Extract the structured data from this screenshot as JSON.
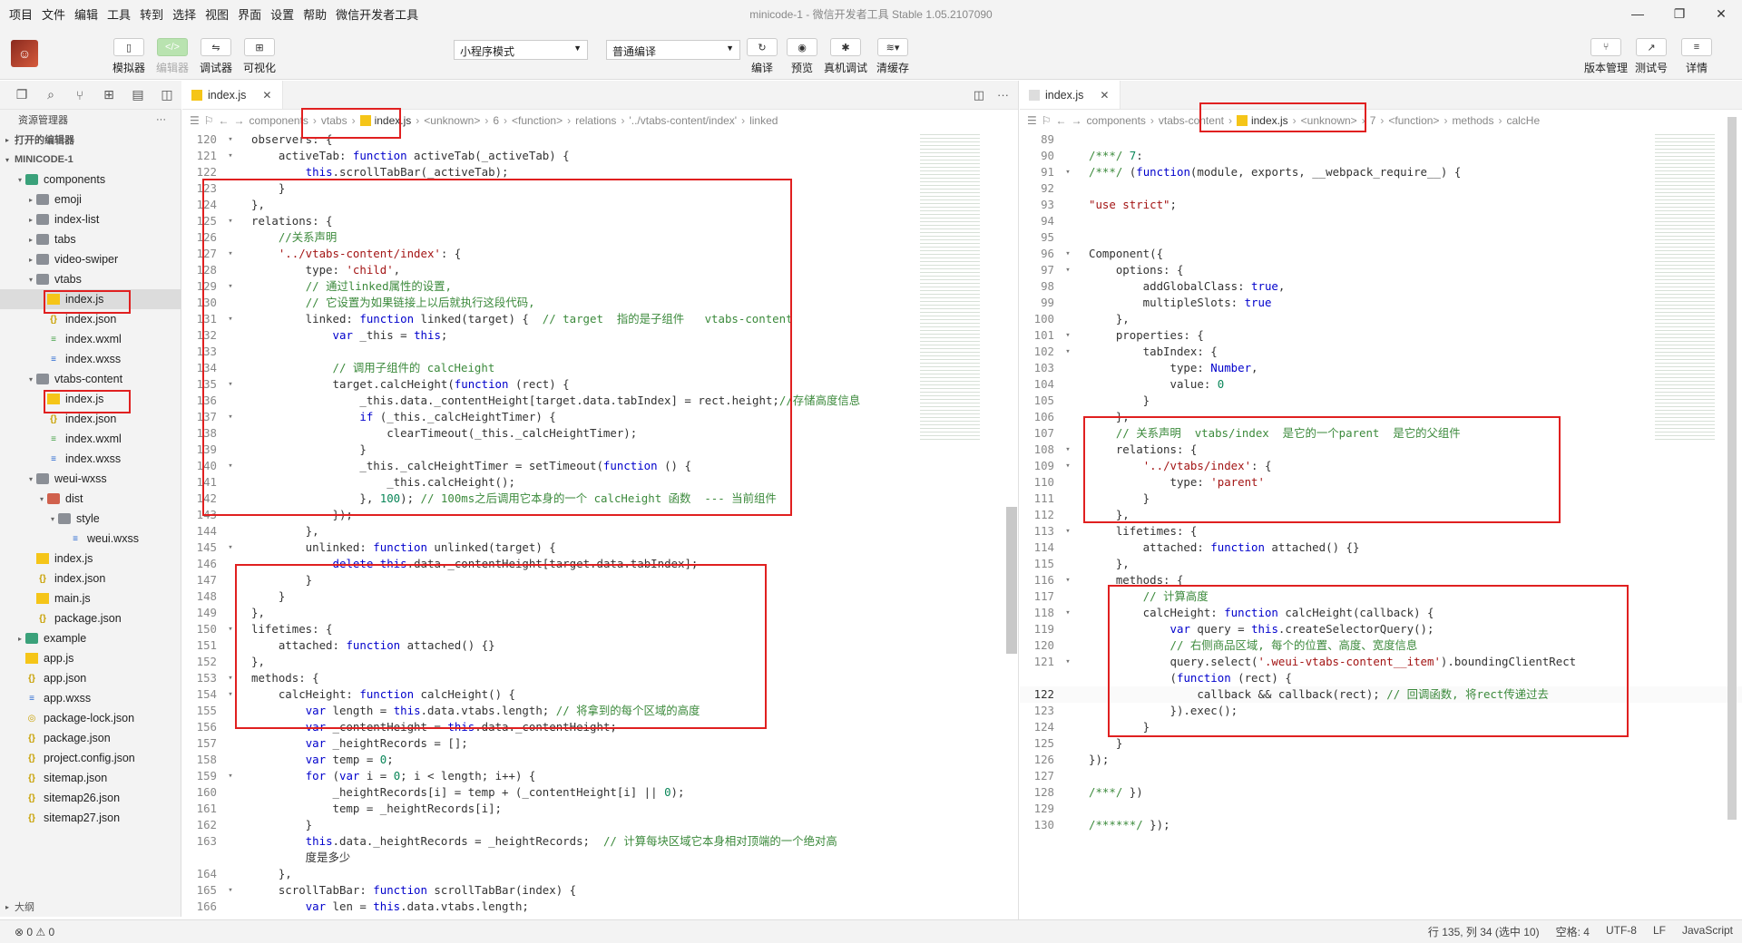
{
  "menu": [
    "项目",
    "文件",
    "编辑",
    "工具",
    "转到",
    "选择",
    "视图",
    "界面",
    "设置",
    "帮助",
    "微信开发者工具"
  ],
  "window_title": "minicode-1 - 微信开发者工具 Stable 1.05.2107090",
  "toolbar": {
    "left": [
      "模拟器",
      "编辑器",
      "调试器",
      "可视化"
    ],
    "mode_select": "小程序模式",
    "compile_select": "普通编译",
    "mid": [
      "编译",
      "预览",
      "真机调试",
      "清缓存"
    ],
    "right": [
      "版本管理",
      "测试号",
      "详情"
    ]
  },
  "sidebar": {
    "title": "资源管理器",
    "open_editors": "打开的编辑器",
    "project": "MINICODE-1",
    "outline": "大纲",
    "items": [
      {
        "depth": 1,
        "arrow": "▾",
        "icon": "folder-green",
        "name": "components"
      },
      {
        "depth": 2,
        "arrow": "▸",
        "icon": "folder",
        "name": "emoji"
      },
      {
        "depth": 2,
        "arrow": "▸",
        "icon": "folder",
        "name": "index-list"
      },
      {
        "depth": 2,
        "arrow": "▸",
        "icon": "folder",
        "name": "tabs"
      },
      {
        "depth": 2,
        "arrow": "▸",
        "icon": "folder",
        "name": "video-swiper"
      },
      {
        "depth": 2,
        "arrow": "▾",
        "icon": "folder",
        "name": "vtabs"
      },
      {
        "depth": 3,
        "arrow": "",
        "icon": "js",
        "name": "index.js",
        "selected": true,
        "hl": true
      },
      {
        "depth": 3,
        "arrow": "",
        "icon": "json",
        "name": "index.json"
      },
      {
        "depth": 3,
        "arrow": "",
        "icon": "wxml",
        "name": "index.wxml"
      },
      {
        "depth": 3,
        "arrow": "",
        "icon": "wxss",
        "name": "index.wxss"
      },
      {
        "depth": 2,
        "arrow": "▾",
        "icon": "folder",
        "name": "vtabs-content"
      },
      {
        "depth": 3,
        "arrow": "",
        "icon": "js",
        "name": "index.js",
        "hl": true
      },
      {
        "depth": 3,
        "arrow": "",
        "icon": "json",
        "name": "index.json"
      },
      {
        "depth": 3,
        "arrow": "",
        "icon": "wxml",
        "name": "index.wxml"
      },
      {
        "depth": 3,
        "arrow": "",
        "icon": "wxss",
        "name": "index.wxss"
      },
      {
        "depth": 2,
        "arrow": "▾",
        "icon": "folder",
        "name": "weui-wxss"
      },
      {
        "depth": 3,
        "arrow": "▾",
        "icon": "folder-red",
        "name": "dist"
      },
      {
        "depth": 4,
        "arrow": "▾",
        "icon": "folder",
        "name": "style"
      },
      {
        "depth": 5,
        "arrow": "",
        "icon": "wxss",
        "name": "weui.wxss"
      },
      {
        "depth": 2,
        "arrow": "",
        "icon": "js",
        "name": "index.js"
      },
      {
        "depth": 2,
        "arrow": "",
        "icon": "json",
        "name": "index.json"
      },
      {
        "depth": 2,
        "arrow": "",
        "icon": "js",
        "name": "main.js"
      },
      {
        "depth": 2,
        "arrow": "",
        "icon": "json",
        "name": "package.json"
      },
      {
        "depth": 1,
        "arrow": "▸",
        "icon": "folder-green",
        "name": "example"
      },
      {
        "depth": 1,
        "arrow": "",
        "icon": "js",
        "name": "app.js"
      },
      {
        "depth": 1,
        "arrow": "",
        "icon": "json",
        "name": "app.json"
      },
      {
        "depth": 1,
        "arrow": "",
        "icon": "wxss",
        "name": "app.wxss"
      },
      {
        "depth": 1,
        "arrow": "",
        "icon": "lock",
        "name": "package-lock.json"
      },
      {
        "depth": 1,
        "arrow": "",
        "icon": "json",
        "name": "package.json"
      },
      {
        "depth": 1,
        "arrow": "",
        "icon": "json",
        "name": "project.config.json"
      },
      {
        "depth": 1,
        "arrow": "",
        "icon": "json",
        "name": "sitemap.json"
      },
      {
        "depth": 1,
        "arrow": "",
        "icon": "json",
        "name": "sitemap26.json"
      },
      {
        "depth": 1,
        "arrow": "",
        "icon": "json",
        "name": "sitemap27.json"
      }
    ]
  },
  "left_editor": {
    "tab": "index.js",
    "breadcrumbs": [
      "components",
      "vtabs",
      "index.js",
      "<unknown>",
      "6",
      "<function>",
      "relations",
      "'../vtabs-content/index'",
      "linked"
    ],
    "lines": [
      [
        "120",
        "▾",
        "observers: {"
      ],
      [
        "121",
        "▾",
        "    activeTab: function activeTab(_activeTab) {"
      ],
      [
        "122",
        "",
        "        this.scrollTabBar(_activeTab);"
      ],
      [
        "123",
        "",
        "    }"
      ],
      [
        "124",
        "",
        "},"
      ],
      [
        "125",
        "▾",
        "relations: {"
      ],
      [
        "126",
        "",
        "    //关系声明"
      ],
      [
        "127",
        "▾",
        "    '../vtabs-content/index': {"
      ],
      [
        "128",
        "",
        "        type: 'child',"
      ],
      [
        "129",
        "▾",
        "        // 通过linked属性的设置,"
      ],
      [
        "130",
        "",
        "        // 它设置为如果链接上以后就执行这段代码,"
      ],
      [
        "131",
        "▾",
        "        linked: function linked(target) {  // target  指的是子组件   vtabs-content"
      ],
      [
        "132",
        "",
        "            var _this = this;"
      ],
      [
        "133",
        "",
        ""
      ],
      [
        "134",
        "",
        "            // 调用子组件的 calcHeight"
      ],
      [
        "135",
        "▾",
        "            target.calcHeight(function (rect) {"
      ],
      [
        "136",
        "",
        "                _this.data._contentHeight[target.data.tabIndex] = rect.height;//存储高度信息"
      ],
      [
        "137",
        "▾",
        "                if (_this._calcHeightTimer) {"
      ],
      [
        "138",
        "",
        "                    clearTimeout(_this._calcHeightTimer);"
      ],
      [
        "139",
        "",
        "                }"
      ],
      [
        "140",
        "▾",
        "                _this._calcHeightTimer = setTimeout(function () {"
      ],
      [
        "141",
        "",
        "                    _this.calcHeight();"
      ],
      [
        "142",
        "",
        "                }, 100); // 100ms之后调用它本身的一个 calcHeight 函数  --- 当前组件"
      ],
      [
        "143",
        "",
        "            });"
      ],
      [
        "144",
        "",
        "        },"
      ],
      [
        "145",
        "▾",
        "        unlinked: function unlinked(target) {"
      ],
      [
        "146",
        "",
        "            delete this.data._contentHeight[target.data.tabIndex];"
      ],
      [
        "147",
        "",
        "        }"
      ],
      [
        "148",
        "",
        "    }"
      ],
      [
        "149",
        "",
        "},"
      ],
      [
        "150",
        "▾",
        "lifetimes: {"
      ],
      [
        "151",
        "",
        "    attached: function attached() {}"
      ],
      [
        "152",
        "",
        "},"
      ],
      [
        "153",
        "▾",
        "methods: {"
      ],
      [
        "154",
        "▾",
        "    calcHeight: function calcHeight() {"
      ],
      [
        "155",
        "",
        "        var length = this.data.vtabs.length; // 将拿到的每个区域的高度"
      ],
      [
        "156",
        "",
        "        var _contentHeight = this.data._contentHeight;"
      ],
      [
        "157",
        "",
        "        var _heightRecords = [];"
      ],
      [
        "158",
        "",
        "        var temp = 0;"
      ],
      [
        "159",
        "▾",
        "        for (var i = 0; i < length; i++) {"
      ],
      [
        "160",
        "",
        "            _heightRecords[i] = temp + (_contentHeight[i] || 0);"
      ],
      [
        "161",
        "",
        "            temp = _heightRecords[i];"
      ],
      [
        "162",
        "",
        "        }"
      ],
      [
        "163",
        "",
        "        this.data._heightRecords = _heightRecords;  // 计算每块区域它本身相对顶端的一个绝对高"
      ],
      [
        "",
        "",
        "        度是多少"
      ],
      [
        "164",
        "",
        "    },"
      ],
      [
        "165",
        "▾",
        "    scrollTabBar: function scrollTabBar(index) {"
      ],
      [
        "166",
        "",
        "        var len = this.data.vtabs.length;"
      ]
    ]
  },
  "right_editor": {
    "tab": "index.js",
    "breadcrumbs": [
      "components",
      "vtabs-content",
      "index.js",
      "<unknown>",
      "7",
      "<function>",
      "methods",
      "calcHe"
    ],
    "lines": [
      [
        "89",
        "",
        ""
      ],
      [
        "90",
        "",
        "/***/ 7:"
      ],
      [
        "91",
        "▾",
        "/***/ (function(module, exports, __webpack_require__) {"
      ],
      [
        "92",
        "",
        ""
      ],
      [
        "93",
        "",
        "\"use strict\";"
      ],
      [
        "94",
        "",
        ""
      ],
      [
        "95",
        "",
        ""
      ],
      [
        "96",
        "▾",
        "Component({"
      ],
      [
        "97",
        "▾",
        "    options: {"
      ],
      [
        "98",
        "",
        "        addGlobalClass: true,"
      ],
      [
        "99",
        "",
        "        multipleSlots: true"
      ],
      [
        "100",
        "",
        "    },"
      ],
      [
        "101",
        "▾",
        "    properties: {"
      ],
      [
        "102",
        "▾",
        "        tabIndex: {"
      ],
      [
        "103",
        "",
        "            type: Number,"
      ],
      [
        "104",
        "",
        "            value: 0"
      ],
      [
        "105",
        "",
        "        }"
      ],
      [
        "106",
        "",
        "    },"
      ],
      [
        "107",
        "",
        "    // 关系声明  vtabs/index  是它的一个parent  是它的父组件"
      ],
      [
        "108",
        "▾",
        "    relations: {"
      ],
      [
        "109",
        "▾",
        "        '../vtabs/index': {"
      ],
      [
        "110",
        "",
        "            type: 'parent'"
      ],
      [
        "111",
        "",
        "        }"
      ],
      [
        "112",
        "",
        "    },"
      ],
      [
        "113",
        "▾",
        "    lifetimes: {"
      ],
      [
        "114",
        "",
        "        attached: function attached() {}"
      ],
      [
        "115",
        "",
        "    },"
      ],
      [
        "116",
        "▾",
        "    methods: {"
      ],
      [
        "117",
        "",
        "        // 计算高度"
      ],
      [
        "118",
        "▾",
        "        calcHeight: function calcHeight(callback) {"
      ],
      [
        "119",
        "",
        "            var query = this.createSelectorQuery();"
      ],
      [
        "120",
        "",
        "            // 右侧商品区域, 每个的位置、高度、宽度信息"
      ],
      [
        "121",
        "▾",
        "            query.select('.weui-vtabs-content__item').boundingClientRect"
      ],
      [
        "",
        "",
        "            (function (rect) {"
      ],
      [
        "122",
        "",
        "                callback && callback(rect); // 回调函数, 将rect传递过去"
      ],
      [
        "123",
        "",
        "            }).exec();"
      ],
      [
        "124",
        "",
        "        }"
      ],
      [
        "125",
        "",
        "    }"
      ],
      [
        "126",
        "",
        "});"
      ],
      [
        "127",
        "",
        ""
      ],
      [
        "128",
        "",
        "/***/ })"
      ],
      [
        "129",
        "",
        ""
      ],
      [
        "130",
        "",
        "/******/ });"
      ]
    ]
  },
  "status": {
    "left": "⊗ 0 ⚠ 0",
    "right": [
      "行 135, 列 34 (选中 10)",
      "空格: 4",
      "UTF-8",
      "LF",
      "JavaScript"
    ]
  }
}
